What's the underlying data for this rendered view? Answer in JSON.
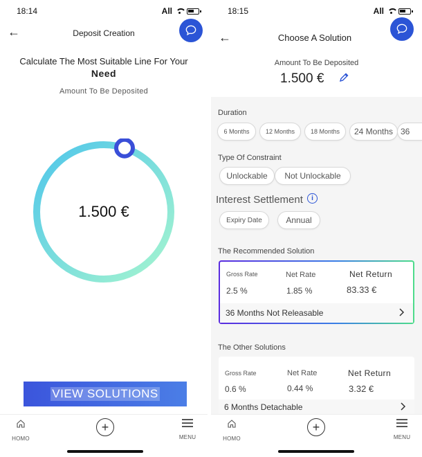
{
  "left": {
    "status": {
      "time": "18:14",
      "carrier": "All"
    },
    "header": {
      "title": "Deposit Creation"
    },
    "calc": {
      "title_line1": "Calculate The Most Suitable Line For Your",
      "title_line2": "Need",
      "amount_label": "Amount To Be Deposited",
      "amount_value": "1.500 €",
      "dial_fraction": 0.97
    },
    "cta": {
      "label": "VIEW SOLUTIONS"
    },
    "nav": {
      "home": "HOMO",
      "menu": "MENU"
    }
  },
  "right": {
    "status": {
      "time": "18:15",
      "carrier": "All"
    },
    "header": {
      "title": "Choose A Solution"
    },
    "amount": {
      "label": "Amount To Be Deposited",
      "value": "1.500 €"
    },
    "duration": {
      "label": "Duration",
      "options": [
        "6 Months",
        "12 Months",
        "18 Months",
        "24 Months",
        "36"
      ]
    },
    "constraint": {
      "label": "Type Of Constraint",
      "options": [
        "Unlockable",
        "Not Unlockable"
      ]
    },
    "settlement": {
      "label": "Interest Settlement",
      "options": [
        "Expiry Date",
        "Annual"
      ]
    },
    "recommended": {
      "section_label": "The Recommended Solution",
      "gross_label": "Gross Rate",
      "net_label": "Net Rate",
      "return_label": "Net Return",
      "gross_value": "2.5 %",
      "net_value": "1.85 %",
      "return_value": "83.33 €",
      "footer": "36 Months Not Releasable"
    },
    "other": {
      "section_label": "The Other Solutions",
      "gross_label": "Gross Rate",
      "net_label": "Net Rate",
      "return_label": "Net Return",
      "gross_value": "0.6 %",
      "net_value": "0.44 %",
      "return_value": "3.32 €",
      "footer": "6 Months Detachable"
    },
    "nav": {
      "home": "HOMO",
      "menu": "MENU"
    }
  },
  "colors": {
    "accent": "#2b54d6",
    "cta_start": "#3b55dc",
    "cta_end": "#4b7ee6",
    "dial_start": "#4fc6ea",
    "dial_end": "#a6f5cf"
  }
}
